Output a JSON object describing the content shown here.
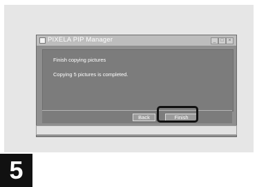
{
  "window": {
    "title": "PIXELA PIP Manager",
    "controls": {
      "minimize": "_",
      "maximize": "□",
      "close": "×"
    }
  },
  "dialog": {
    "heading": "Finish copying pictures",
    "message": "Copying 5 pictures is completed."
  },
  "buttons": {
    "back_label": "Back",
    "finish_label": "Finish"
  },
  "step": {
    "number": "5"
  },
  "colors": {
    "highlight": "#111111",
    "step_badge": "#111111"
  }
}
